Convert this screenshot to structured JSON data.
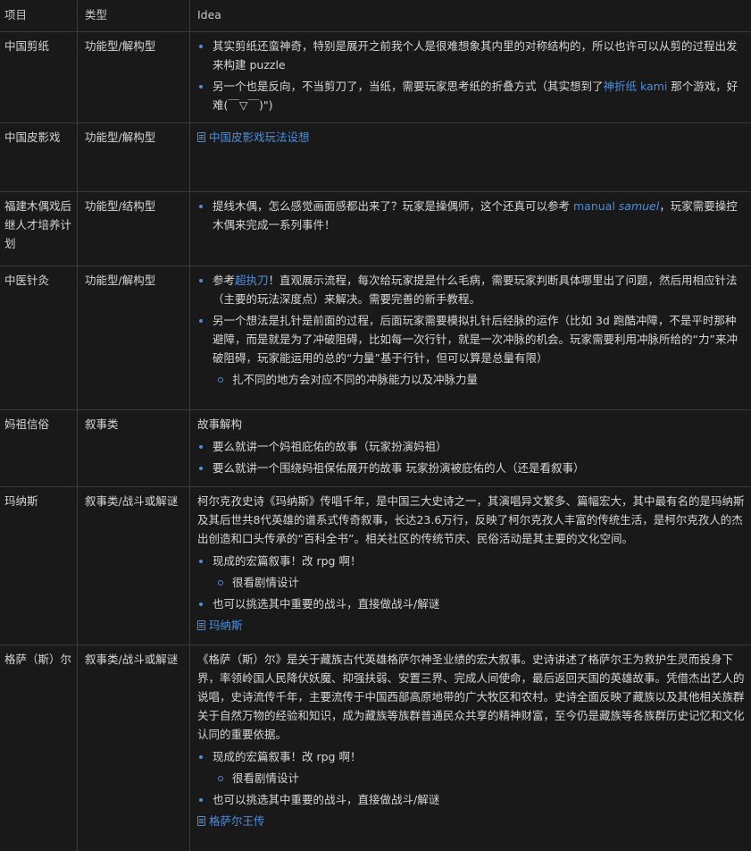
{
  "headers": {
    "project": "项目",
    "type": "类型",
    "idea": "Idea"
  },
  "rows": [
    {
      "project": "中国剪纸",
      "type": "功能型/解构型",
      "bullet1": "其实剪纸还蛮神奇，特别是展开之前我个人是很难想象其内里的对称结构的，所以也许可以从剪的过程出发来构建 puzzle",
      "bullet2_a": "另一个也是反向，不当剪刀了，当纸，需要玩家思考纸的折叠方式（其实想到了",
      "bullet2_link": "神折纸 kami",
      "bullet2_b": " 那个游戏，好难(￣▽￣)\")"
    },
    {
      "project": "中国皮影戏",
      "type": "功能型/解构型",
      "doc_link": "中国皮影戏玩法设想"
    },
    {
      "project": "福建木偶戏后继人才培养计划",
      "type": "功能型/结构型",
      "bullet1_a": "提线木偶，怎么感觉画面感都出来了？玩家是操偶师，这个还真可以参考 ",
      "bullet1_link1": "manual ",
      "bullet1_link2": "samuel",
      "bullet1_b": "，玩家需要操控木偶来完成一系列事件！"
    },
    {
      "project": "中医针灸",
      "type": "功能型/解构型",
      "bullet1_a": "参考",
      "bullet1_link": "超执刀",
      "bullet1_b": "！直观展示流程，每次给玩家提是什么毛病，需要玩家判断具体哪里出了问题，然后用相应针法（主要的玩法深度点）来解决。需要完善的新手教程。",
      "bullet2": "另一个想法是扎针是前面的过程，后面玩家需要模拟扎针后经脉的运作（比如 3d 跑酷冲障，不是平时那种避障，而是就是为了冲破阻碍，比如每一次行针，就是一次冲脉的机会。玩家需要利用冲脉所给的“力”来冲破阻碍，玩家能运用的总的“力量”基于行针，但可以算是总量有限）",
      "sub1": "扎不同的地方会对应不同的冲脉能力以及冲脉力量"
    },
    {
      "project": "妈祖信俗",
      "type": "叙事类",
      "intro": "故事解构",
      "bullet1": "要么就讲一个妈祖庇佑的故事（玩家扮演妈祖）",
      "bullet2": "要么就讲一个围绕妈祖保佑展开的故事 玩家扮演被庇佑的人（还是看叙事）"
    },
    {
      "project": "玛纳斯",
      "type": "叙事类/战斗或解谜",
      "intro": "柯尔克孜史诗《玛纳斯》传唱千年，是中国三大史诗之一，其演唱异文繁多、篇幅宏大，其中最有名的是玛纳斯及其后世共8代英雄的谱系式传奇叙事，长达23.6万行，反映了柯尔克孜人丰富的传统生活，是柯尔克孜人的杰出创造和口头传承的“百科全书”。相关社区的传统节庆、民俗活动是其主要的文化空间。",
      "bullet1": "现成的宏篇叙事！改 rpg 啊！",
      "sub1": "很看剧情设计",
      "bullet2": "也可以挑选其中重要的战斗，直接做战斗/解谜",
      "doc_link": "玛纳斯"
    },
    {
      "project": "格萨（斯）尔",
      "type": "叙事类/战斗或解谜",
      "intro": "《格萨（斯）尔》是关于藏族古代英雄格萨尔神圣业绩的宏大叙事。史诗讲述了格萨尔王为救护生灵而投身下界，率领岭国人民降伏妖魔、抑强扶弱、安置三界、完成人间使命，最后返回天国的英雄故事。凭借杰出艺人的说唱，史诗流传千年，主要流传于中国西部高原地带的广大牧区和农村。史诗全面反映了藏族以及其他相关族群关于自然万物的经验和知识，成为藏族等族群普通民众共享的精神财富，至今仍是藏族等各族群历史记忆和文化认同的重要依据。",
      "bullet1": "现成的宏篇叙事！改 rpg 啊！",
      "sub1": "很看剧情设计",
      "bullet2": "也可以挑选其中重要的战斗，直接做战斗/解谜",
      "doc_link": "格萨尔王传"
    }
  ]
}
